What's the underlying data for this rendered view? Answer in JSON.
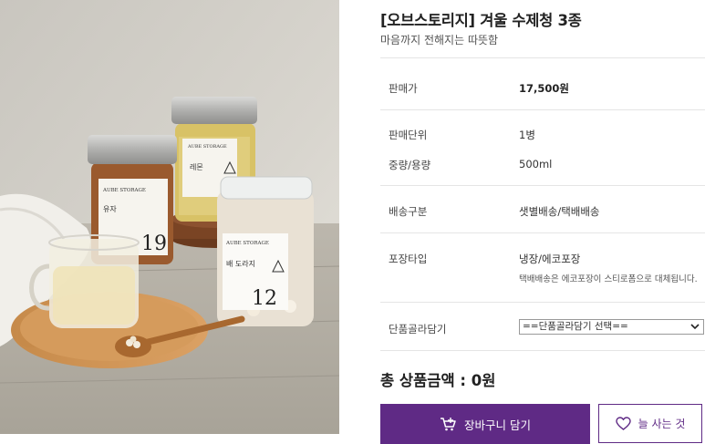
{
  "product": {
    "title": "[오브스토리지] 겨울 수제청 3종",
    "subtitle": "마음까지 전해지는 따뜻함",
    "image_alt": "오브스토리지 수제청 유리병 3종 사진"
  },
  "jars": {
    "brand": "AUBE STORAGE",
    "left_name": "유자",
    "left_number": "19",
    "back_name": "레몬",
    "front_name": "배 도라지",
    "front_number": "12"
  },
  "details": {
    "price_label": "판매가",
    "price_value": "17,500원",
    "unit_label": "판매단위",
    "unit_value": "1병",
    "weight_label": "중량/용량",
    "weight_value": "500ml",
    "delivery_label": "배송구분",
    "delivery_value": "샛별배송/택배배송",
    "packing_label": "포장타입",
    "packing_value": "냉장/에코포장",
    "packing_note": "택배배송은 에코포장이 스티로폼으로 대체됩니다.",
    "option_label": "단품골라담기",
    "option_selected": "==단품골라담기 선택=="
  },
  "summary": {
    "total_label": "총 상품금액 : 0원"
  },
  "actions": {
    "cart_label": "장바구니 담기",
    "wish_label": "늘 사는 것"
  },
  "colors": {
    "accent": "#5f2a85"
  }
}
